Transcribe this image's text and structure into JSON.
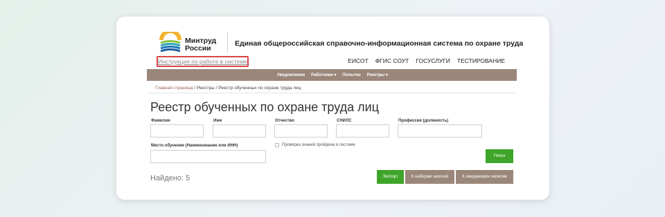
{
  "brand": {
    "line1": "Минтруд",
    "line2": "России"
  },
  "site_title": "Единая общероссийская справочно-информационная система по охране труда",
  "instruction_link": "Инструкция по работе в системе",
  "top_links": [
    "ЕИСОТ",
    "ФГИС СОУТ",
    "ГОСУСЛУГИ",
    "ТЕСТИРОВАНИЕ"
  ],
  "navbar": [
    "Уведомления",
    "Работники ▾",
    "Попытки",
    "Реестры ▾"
  ],
  "breadcrumb": {
    "home": "Главная страница",
    "sep1": " / ",
    "registries": "Реестры",
    "sep2": " / ",
    "current": "Реестр обученных по охране труда лиц"
  },
  "page_title": "Реестр обученных по охране труда лиц",
  "fields": {
    "last_name": {
      "label": "Фамилия",
      "value": ""
    },
    "first_name": {
      "label": "Имя",
      "value": ""
    },
    "patronymic": {
      "label": "Отчество",
      "value": ""
    },
    "snils": {
      "label": "СНИЛС",
      "value": ""
    },
    "profession": {
      "label": "Профессия (должность)",
      "value": ""
    },
    "training_place": {
      "label": "Место обучения (Наименование или ИНН)",
      "value": ""
    }
  },
  "checkbox_label": "Проверка знаний пройдена в системе",
  "buttons": {
    "search": "Поиск",
    "export": "Экспорт",
    "to_sets": "К наборам записей",
    "to_pending": "К ожидающим записям"
  },
  "found_text": "Найдено: 5",
  "colors": {
    "nav": "#9b877a",
    "green": "#3ea52a",
    "highlight": "#d94545",
    "link": "#a05b5b"
  }
}
